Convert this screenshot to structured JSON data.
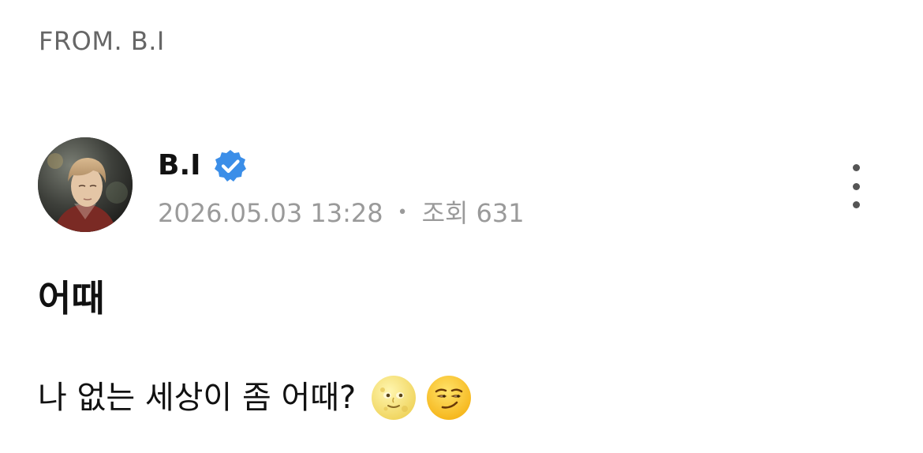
{
  "header": {
    "from_label": "FROM. B.I"
  },
  "author": {
    "name": "B.I",
    "verified": true,
    "verified_icon": "verified-badge-icon",
    "badge_color": "#3b8ee8"
  },
  "meta": {
    "timestamp": "2026.05.03 13:28",
    "separator": "•",
    "views_label": "조회",
    "views_count": "631"
  },
  "actions": {
    "more_icon": "more-vertical-icon"
  },
  "post": {
    "title": "어때",
    "body_text": "나 없는 세상이 좀 어때?",
    "emojis": [
      "full-moon-face-icon",
      "smirking-face-icon"
    ]
  }
}
